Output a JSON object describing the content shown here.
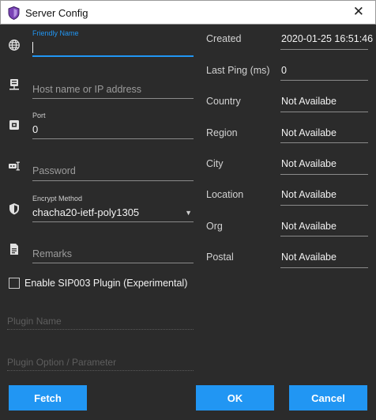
{
  "window": {
    "title": "Server Config",
    "close_glyph": "✕"
  },
  "form": {
    "friendly_name": {
      "label": "Friendly Name",
      "value": ""
    },
    "host": {
      "placeholder": "Host name or IP address"
    },
    "port": {
      "label": "Port",
      "value": "0"
    },
    "password": {
      "placeholder": "Password"
    },
    "encrypt": {
      "label": "Encrypt Method",
      "value": "chacha20-ietf-poly1305"
    },
    "remarks": {
      "placeholder": "Remarks"
    }
  },
  "info": {
    "rows": [
      {
        "label": "Created",
        "value": "2020-01-25 16:51:46"
      },
      {
        "label": "Last Ping (ms)",
        "value": "0"
      },
      {
        "label": "Country",
        "value": "Not Availabe"
      },
      {
        "label": "Region",
        "value": "Not Availabe"
      },
      {
        "label": "City",
        "value": "Not Availabe"
      },
      {
        "label": "Location",
        "value": "Not Availabe"
      },
      {
        "label": "Org",
        "value": "Not Availabe"
      },
      {
        "label": "Postal",
        "value": "Not Availabe"
      }
    ]
  },
  "plugin": {
    "checkbox_label": "Enable SIP003 Plugin (Experimental)",
    "checked": false,
    "name_placeholder": "Plugin Name",
    "option_placeholder": "Plugin Option / Parameter"
  },
  "buttons": {
    "fetch": "Fetch",
    "ok": "OK",
    "cancel": "Cancel"
  },
  "icons": [
    "shield-app-icon",
    "globe-icon",
    "server-icon",
    "port-icon",
    "key-icon",
    "shield-icon",
    "note-icon",
    "chevron-down-icon",
    "close-icon"
  ],
  "colors": {
    "accent": "#2196f3",
    "background": "#2b2b2b",
    "titlebar": "#ffffff",
    "app_icon": "#7a43b6"
  }
}
